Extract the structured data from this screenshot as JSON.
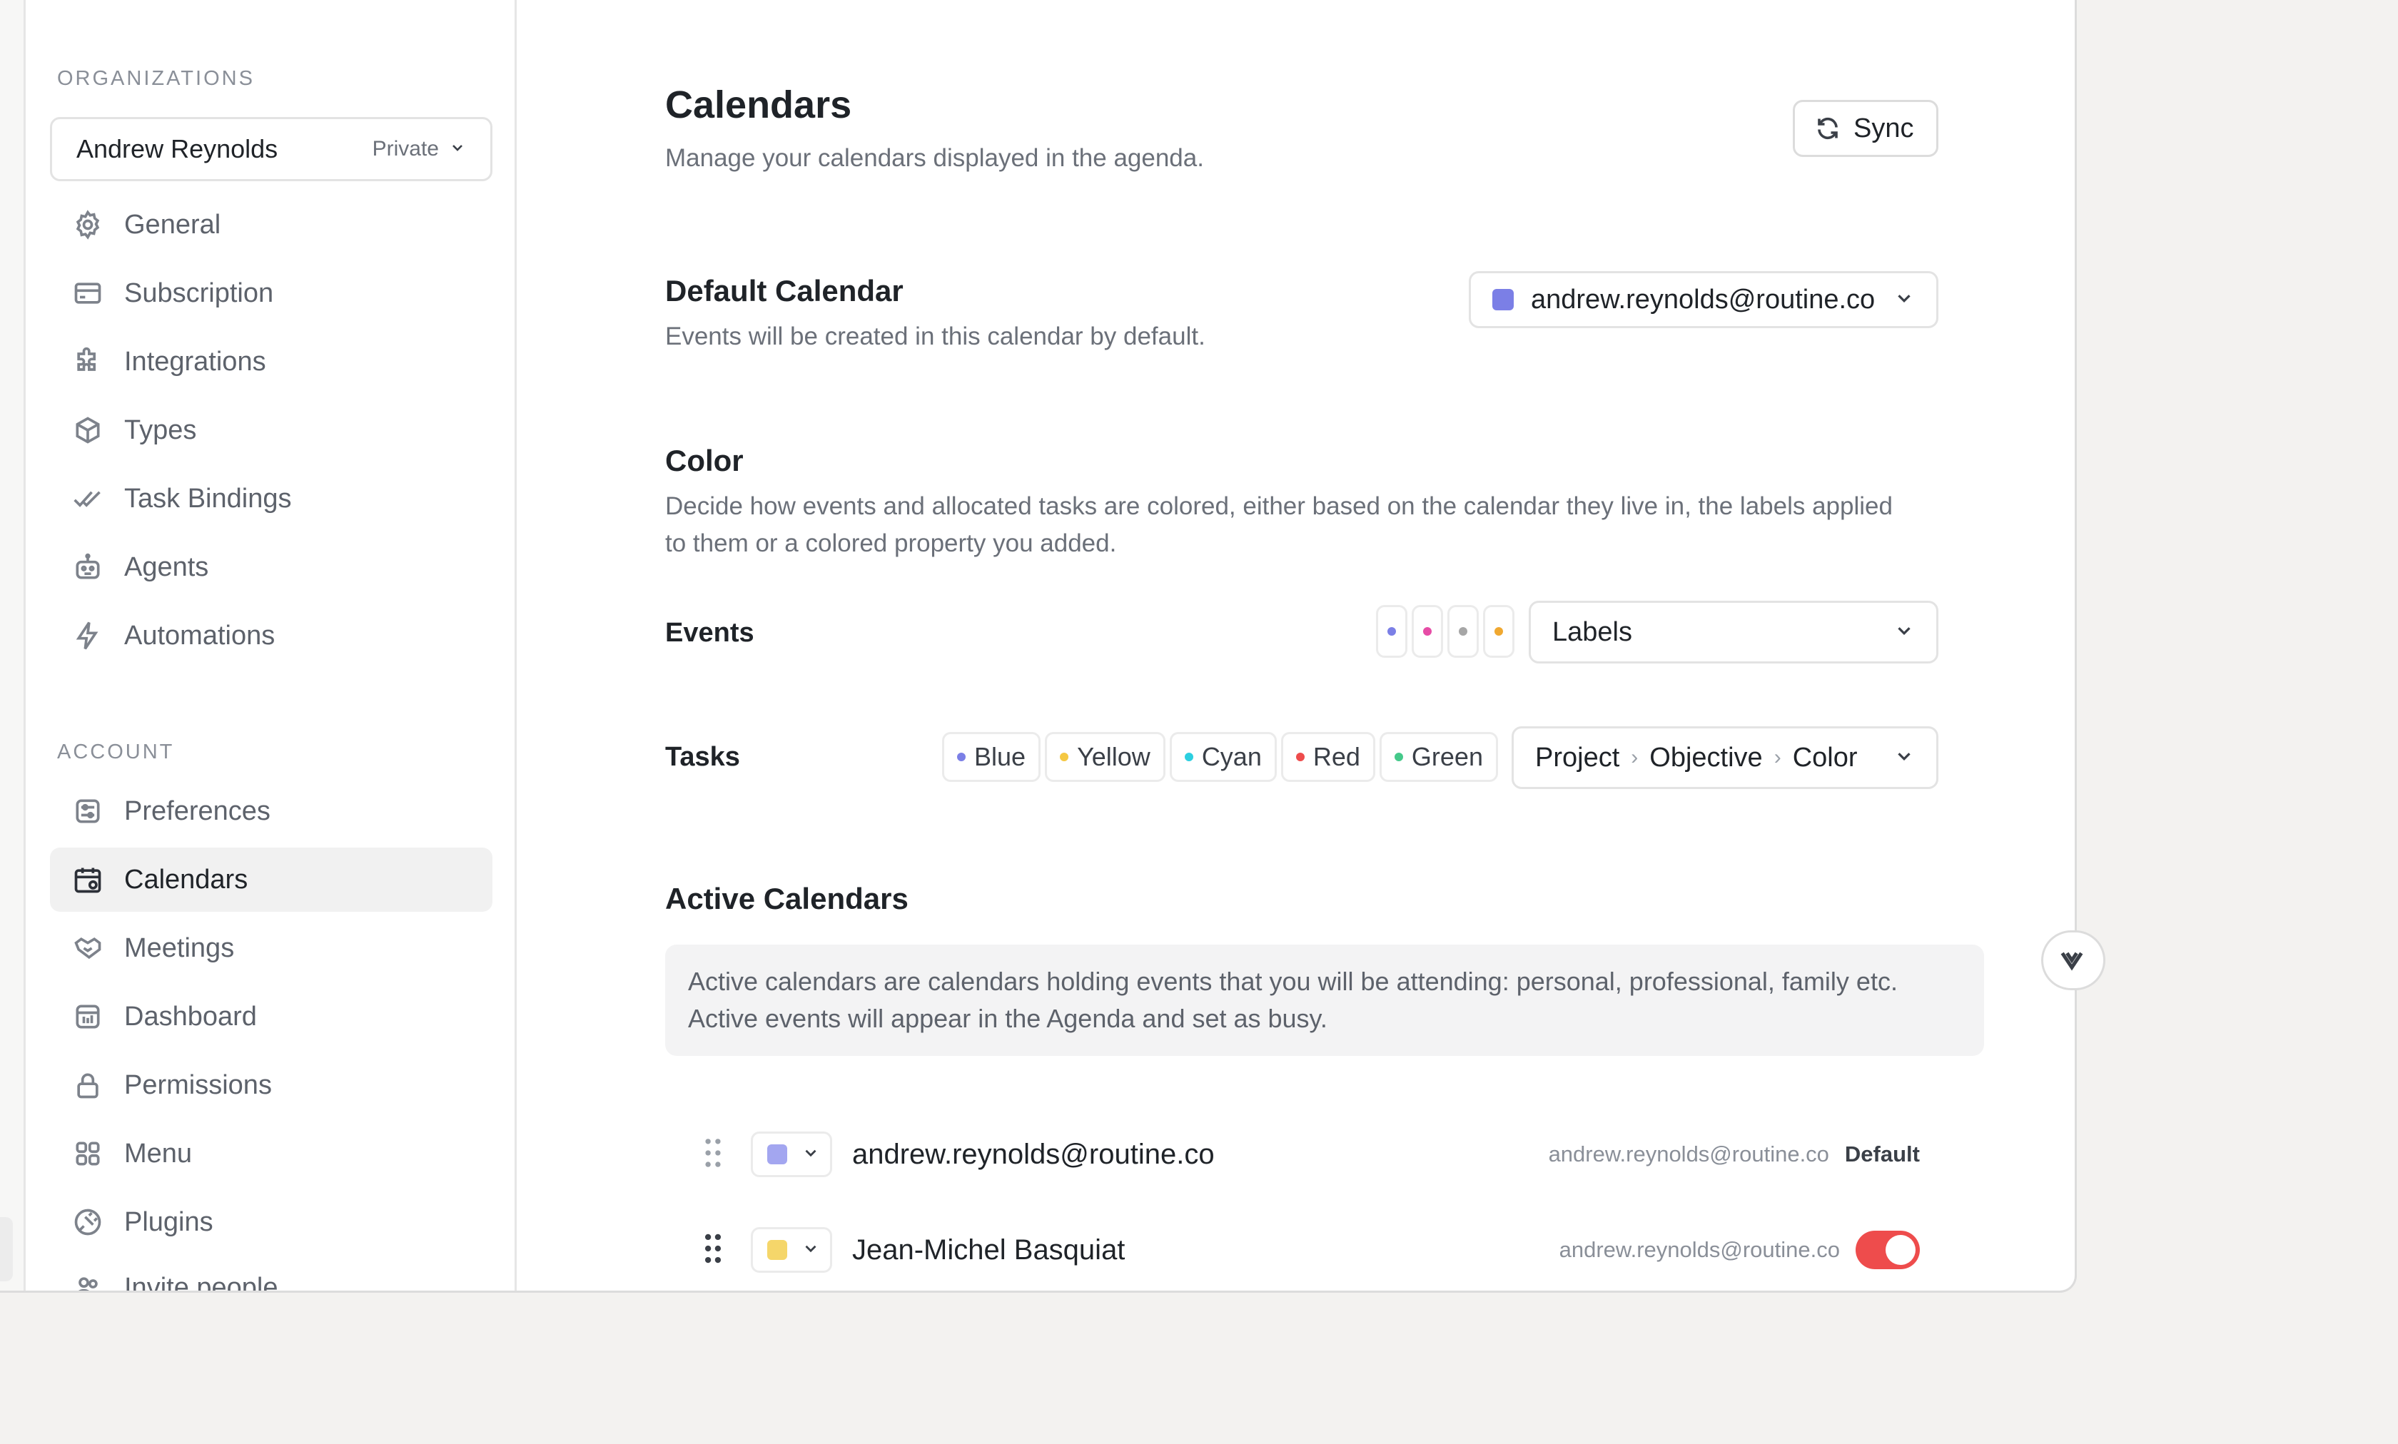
{
  "sidebar": {
    "organizations_label": "ORGANIZATIONS",
    "org_select": {
      "name": "Andrew Reynolds",
      "badge": "Private"
    },
    "org_items": [
      {
        "label": "General",
        "icon": "gear-icon"
      },
      {
        "label": "Subscription",
        "icon": "card-icon"
      },
      {
        "label": "Integrations",
        "icon": "puzzle-icon"
      },
      {
        "label": "Types",
        "icon": "cube-icon"
      },
      {
        "label": "Task Bindings",
        "icon": "double-check-icon"
      },
      {
        "label": "Agents",
        "icon": "robot-icon"
      },
      {
        "label": "Automations",
        "icon": "bolt-icon"
      }
    ],
    "account_label": "ACCOUNT",
    "account_items": [
      {
        "label": "Preferences",
        "icon": "sliders-icon"
      },
      {
        "label": "Calendars",
        "icon": "calendar-icon",
        "active": true
      },
      {
        "label": "Meetings",
        "icon": "handshake-icon"
      },
      {
        "label": "Dashboard",
        "icon": "dashboard-icon"
      },
      {
        "label": "Permissions",
        "icon": "lock-icon"
      },
      {
        "label": "Menu",
        "icon": "grid-icon"
      },
      {
        "label": "Plugins",
        "icon": "plug-icon"
      },
      {
        "label": "Invite people",
        "icon": "people-icon"
      }
    ]
  },
  "header": {
    "title": "Calendars",
    "subtitle": "Manage your calendars displayed in the agenda.",
    "sync_label": "Sync"
  },
  "default_calendar": {
    "title": "Default Calendar",
    "description": "Events will be created in this calendar by default.",
    "selected": "andrew.reynolds@routine.co",
    "swatch_color": "#7b7fe6"
  },
  "color": {
    "title": "Color",
    "description": "Decide how events and allocated tasks are colored, either based on the calendar they live in, the labels applied to them or a colored property you added.",
    "events": {
      "label": "Events",
      "dots": [
        "#7b7fe6",
        "#e64ca6",
        "#a6a6a6",
        "#f0a830"
      ],
      "selected": "Labels"
    },
    "tasks": {
      "label": "Tasks",
      "chips": [
        {
          "label": "Blue",
          "color": "#7b7fe6"
        },
        {
          "label": "Yellow",
          "color": "#f5c842"
        },
        {
          "label": "Cyan",
          "color": "#2ccfe0"
        },
        {
          "label": "Red",
          "color": "#ee4c4c"
        },
        {
          "label": "Green",
          "color": "#45c98a"
        }
      ],
      "path": [
        "Project",
        "Objective",
        "Color"
      ]
    }
  },
  "active_calendars": {
    "title": "Active Calendars",
    "info_line1": "Active calendars are calendars holding events that you will be attending: personal, professional, family etc.",
    "info_line2": "Active events will appear in the Agenda and set as busy.",
    "rows": [
      {
        "name": "andrew.reynolds@routine.co",
        "account": "andrew.reynolds@routine.co",
        "tag": "Default",
        "color": "#a3a6f0"
      },
      {
        "name": "Jean-Michel Basquiat",
        "account": "andrew.reynolds@routine.co",
        "toggle_on": true,
        "color": "#f5d66a"
      }
    ]
  }
}
